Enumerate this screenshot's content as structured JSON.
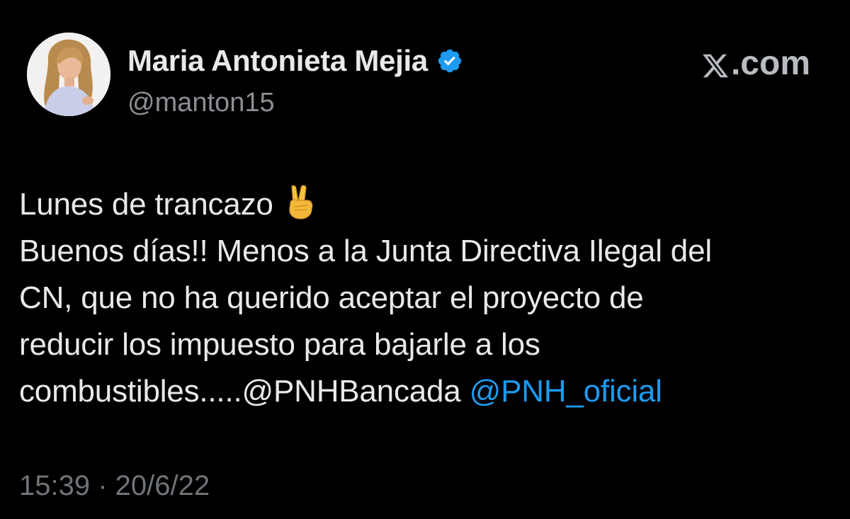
{
  "author": {
    "display_name": "Maria Antonieta Mejia",
    "handle": "@manton15",
    "verified_icon": "verified-badge-icon",
    "avatar_icon": "avatar-photo"
  },
  "brand": {
    "label": ".com",
    "icon": "x-logo-icon"
  },
  "tweet": {
    "line1": "Lunes de trancazo",
    "line1_emoji": "victory-hand-emoji",
    "line2": "Buenos días!! Menos a la Junta Directiva Ilegal del",
    "line3": "CN, que no ha querido aceptar el proyecto de",
    "line4": "reducir los impuesto para bajarle a los",
    "line5_text": "combustibles.....@PNHBancada ",
    "line5_mention": "@PNH_oficial"
  },
  "meta": {
    "timestamp": "15:39 · 20/6/22"
  },
  "colors": {
    "background": "#000000",
    "text": "#e7e9ea",
    "secondary_text": "#8b8f94",
    "link": "#1d9bf0",
    "verified": "#1d9bf0"
  }
}
